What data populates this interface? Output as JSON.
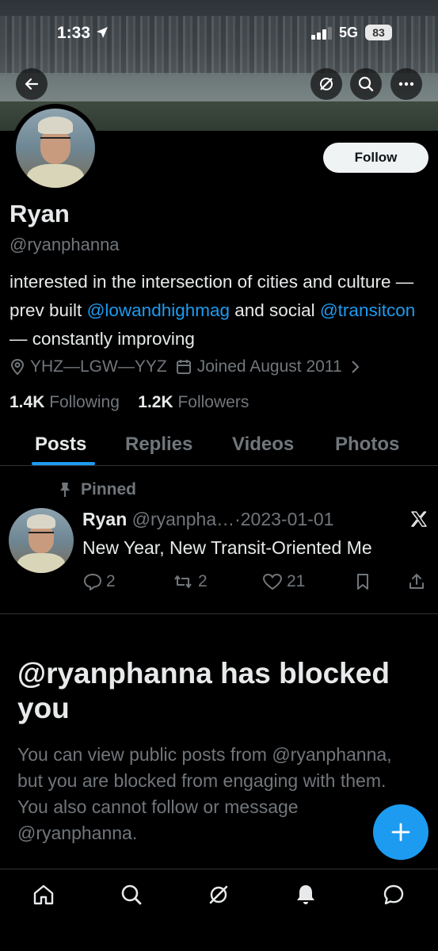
{
  "status_bar": {
    "time": "1:33",
    "network": "5G",
    "battery": "83"
  },
  "profile": {
    "follow_label": "Follow",
    "name": "Ryan",
    "handle": "@ryanphanna",
    "bio_prefix": "interested in the intersection of cities and culture — prev built ",
    "bio_link1": "@lowandhighmag",
    "bio_mid": " and social ",
    "bio_link2": "@transitcon",
    "bio_suffix": " — constantly improving",
    "location": "YHZ—LGW—YYZ",
    "joined": "Joined August 2011",
    "following_count": "1.4K",
    "following_label": "Following",
    "followers_count": "1.2K",
    "followers_label": "Followers"
  },
  "tabs": [
    {
      "label": "Posts",
      "active": true
    },
    {
      "label": "Replies"
    },
    {
      "label": "Videos"
    },
    {
      "label": "Photos"
    }
  ],
  "pinned_post": {
    "pinned_label": "Pinned",
    "author_name": "Ryan",
    "author_handle": "@ryanpha…",
    "date": "·2023-01-01",
    "text": "New Year, New Transit-Oriented Me",
    "replies": "2",
    "reposts": "2",
    "likes": "21"
  },
  "blocked": {
    "title": "@ryanphanna has blocked you",
    "message": "You can view public posts from @ryanphanna, but you are blocked from engaging with them. You also cannot follow or message @ryanphanna."
  },
  "colors": {
    "accent": "#1d9bf0",
    "text": "#e7e9ea",
    "muted": "#71767b",
    "background": "#000000"
  },
  "bottom_nav": [
    "home-icon",
    "search-icon",
    "grok-icon",
    "bell-icon",
    "messages-icon"
  ]
}
